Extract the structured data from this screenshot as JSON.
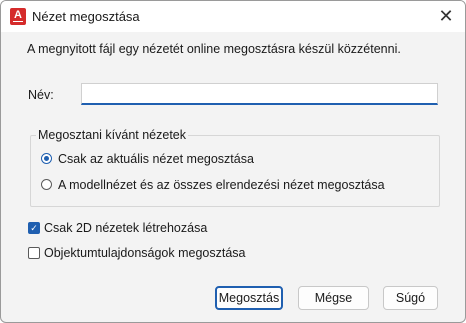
{
  "window": {
    "title": "Nézet megosztása",
    "close_glyph": "✕",
    "app_icon": "autocad-icon"
  },
  "description": "A megnyitott fájl egy nézetét online megosztásra készül közzétenni.",
  "name_field": {
    "label": "Név:",
    "value": ""
  },
  "group": {
    "legend": "Megosztani kívánt nézetek",
    "options": [
      {
        "label": "Csak az aktuális nézet megosztása",
        "selected": true
      },
      {
        "label": "A modellnézet és az összes elrendezési nézet megosztása",
        "selected": false
      }
    ]
  },
  "checkboxes": [
    {
      "label": "Csak 2D nézetek létrehozása",
      "checked": true
    },
    {
      "label": "Objektumtulajdonságok megosztása",
      "checked": false
    }
  ],
  "buttons": {
    "share": "Megosztás",
    "cancel": "Mégse",
    "help": "Súgó"
  },
  "colors": {
    "accent": "#1f5fb0",
    "app_icon": "#d52b2b"
  }
}
